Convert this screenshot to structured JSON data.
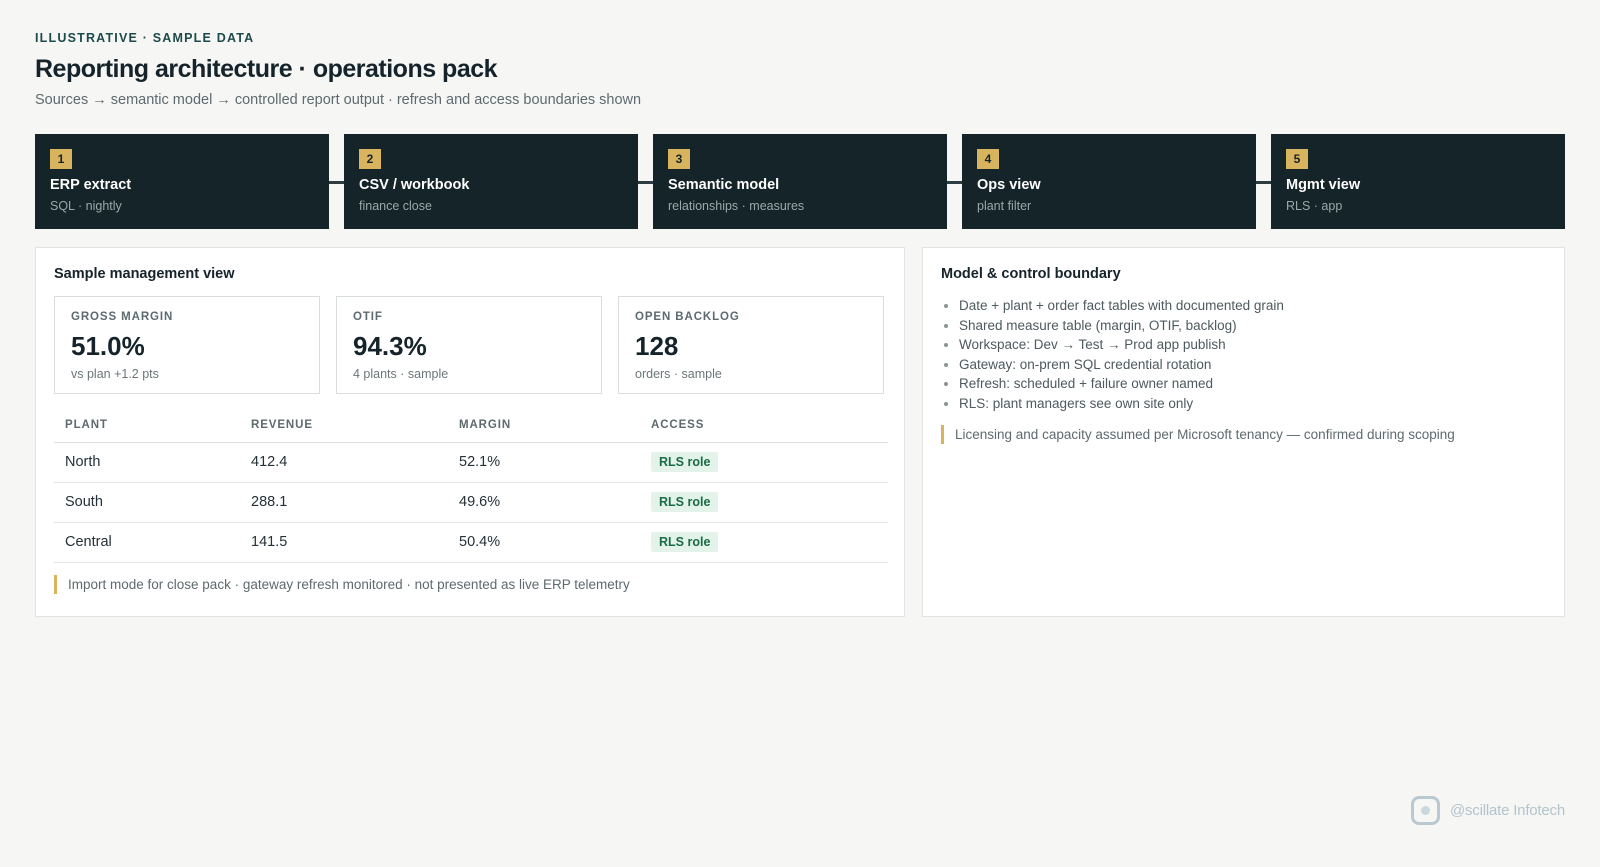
{
  "header": {
    "eyebrow": "ILLUSTRATIVE · SAMPLE DATA",
    "title": "Reporting architecture · operations pack",
    "subtitle": "Sources → semantic model → controlled report output · refresh and access boundaries shown"
  },
  "pipeline": [
    {
      "num": "1",
      "title": "ERP extract",
      "sub": "SQL · nightly"
    },
    {
      "num": "2",
      "title": "CSV / workbook",
      "sub": "finance close"
    },
    {
      "num": "3",
      "title": "Semantic model",
      "sub": "relationships · measures"
    },
    {
      "num": "4",
      "title": "Ops view",
      "sub": "plant filter"
    },
    {
      "num": "5",
      "title": "Mgmt view",
      "sub": "RLS · app"
    }
  ],
  "management": {
    "title": "Sample management view",
    "kpis": [
      {
        "label": "GROSS MARGIN",
        "value": "51.0%",
        "note": "vs plan +1.2 pts"
      },
      {
        "label": "OTIF",
        "value": "94.3%",
        "note": "4 plants · sample"
      },
      {
        "label": "OPEN BACKLOG",
        "value": "128",
        "note": "orders · sample"
      }
    ],
    "table": {
      "headers": [
        "PLANT",
        "REVENUE",
        "MARGIN",
        "ACCESS"
      ],
      "rows": [
        [
          "North",
          "412.4",
          "52.1%",
          "RLS role"
        ],
        [
          "South",
          "288.1",
          "49.6%",
          "RLS role"
        ],
        [
          "Central",
          "141.5",
          "50.4%",
          "RLS role"
        ]
      ]
    },
    "note": "Import mode for close pack · gateway refresh monitored · not presented as live ERP telemetry"
  },
  "boundary": {
    "title": "Model & control boundary",
    "bullets": [
      "Date + plant + order fact tables with documented grain",
      "Shared measure table (margin, OTIF, backlog)",
      "Workspace: Dev → Test → Prod app publish",
      "Gateway: on-prem SQL credential rotation",
      "Refresh: scheduled + failure owner named",
      "RLS: plant managers see own site only"
    ],
    "note": "Licensing and capacity assumed per Microsoft tenancy — confirmed during scoping"
  },
  "brand": {
    "name": "@scillate Infotech",
    "icon": "brand-logo-icon"
  },
  "colors": {
    "stage_bg": "#142428",
    "accent_gold": "#d9b45f",
    "badge_bg": "#e4f3ea",
    "badge_text": "#1b6b45",
    "eyebrow": "#1d4b4b"
  }
}
